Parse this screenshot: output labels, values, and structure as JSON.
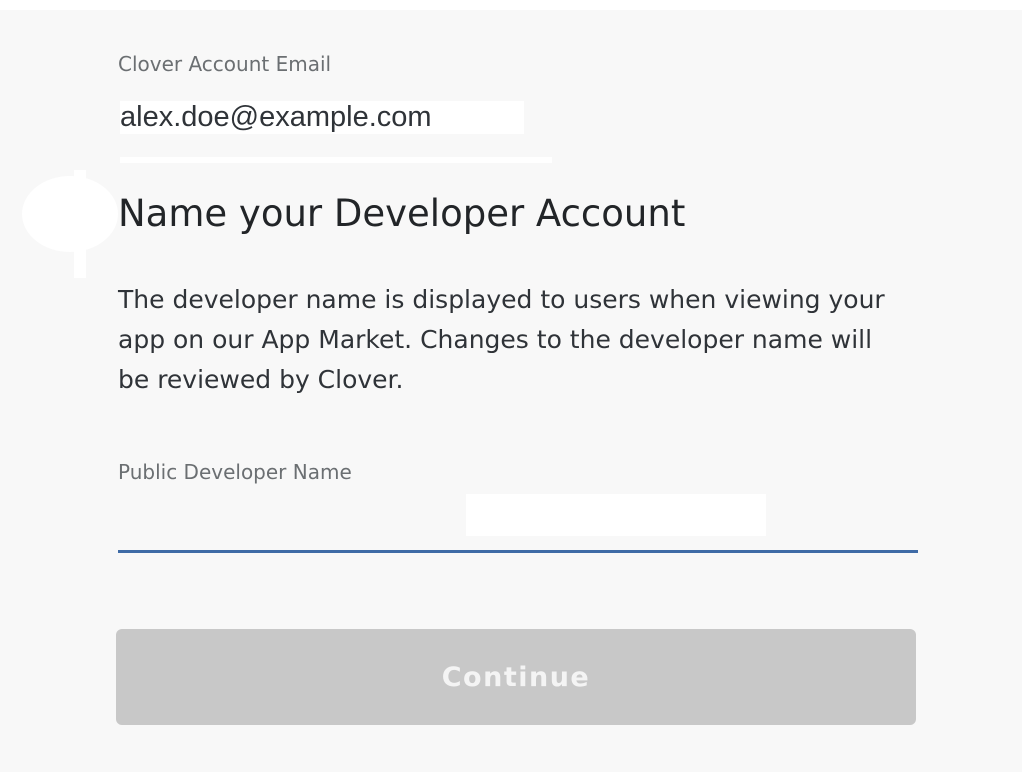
{
  "account": {
    "email_label": "Clover Account Email",
    "email_value": "alex.doe@example.com"
  },
  "developer_account": {
    "heading": "Name your Developer Account",
    "description": "The developer name is displayed to users when viewing your app on our App Market. Changes to the developer name will be reviewed by Clover.",
    "name_label": "Public Developer Name",
    "name_value": "",
    "name_placeholder": ""
  },
  "actions": {
    "continue_label": "Continue",
    "continue_enabled": false
  },
  "colors": {
    "panel_background": "#f8f8f8",
    "field_underline_active": "#3f6ba6",
    "button_disabled_background": "#c8c8c8",
    "button_disabled_text": "#f4f4f4",
    "heading_text": "#222528",
    "label_text": "#6b6f72"
  }
}
